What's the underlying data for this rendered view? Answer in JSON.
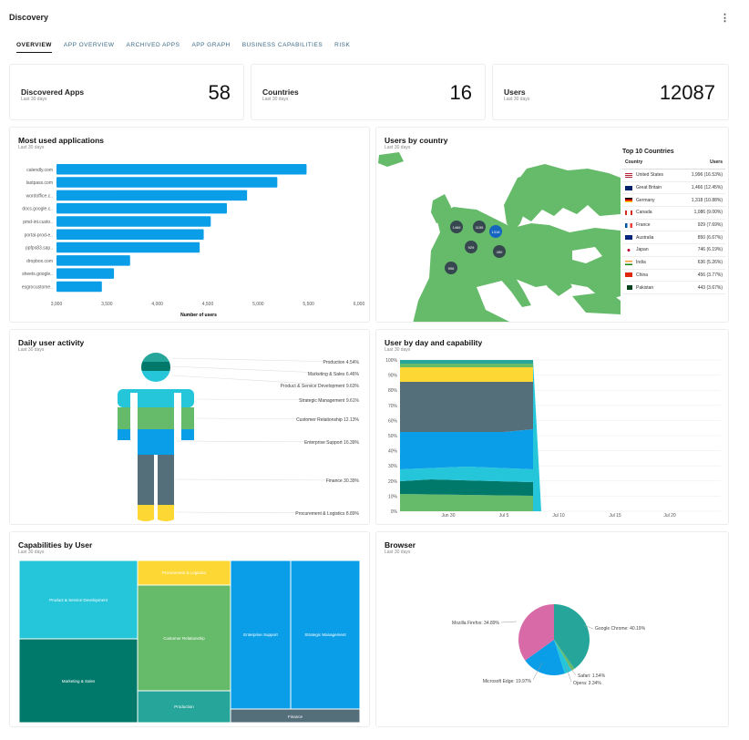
{
  "header": {
    "title": "Discovery",
    "menu_icon": "kebab-menu-icon"
  },
  "tabs": [
    "OVERVIEW",
    "APP OVERVIEW",
    "ARCHIVED APPS",
    "APP GRAPH",
    "BUSINESS CAPABILITIES",
    "RISK"
  ],
  "stats": [
    {
      "title": "Discovered Apps",
      "sub": "Last 30 days",
      "value": "58"
    },
    {
      "title": "Countries",
      "sub": "Last 30 days",
      "value": "16"
    },
    {
      "title": "Users",
      "sub": "Last 30 days",
      "value": "12087"
    }
  ],
  "most_used": {
    "title": "Most used applications",
    "sub": "Last 30 days",
    "chart_data": {
      "type": "bar",
      "orientation": "horizontal",
      "categories": [
        "calendly.com",
        "lastpass.com",
        "wordoffice.c..",
        "docs.google.c..",
        "pmd-int.custo..",
        "portal-prod-e..",
        "ppfps83.sap..",
        "dropbox.com",
        "sheets.google..",
        "esgrocustome.."
      ],
      "values": [
        5480,
        5190,
        4890,
        4690,
        4530,
        4460,
        4420,
        3730,
        3570,
        3450
      ],
      "xlabel": "Number of users",
      "xticks": [
        "3,000",
        "3,500",
        "4,000",
        "4,500",
        "5,000",
        "5,500",
        "6,000"
      ],
      "xlim": [
        3000,
        6000
      ],
      "color": "#0a9ee8"
    }
  },
  "users_by_country": {
    "title": "Users by country",
    "sub": "Last 30 days",
    "map_clusters": [
      "1466",
      "1155",
      "1318",
      "929",
      "450",
      "996"
    ],
    "top10": {
      "title": "Top 10 Countries",
      "col_country": "Country",
      "col_users": "Users",
      "rows": [
        {
          "country": "United States",
          "users": "1,996 (16.53%)"
        },
        {
          "country": "Great Britain",
          "users": "1,466 (12.45%)"
        },
        {
          "country": "Germany",
          "users": "1,318 (10.88%)"
        },
        {
          "country": "Canada",
          "users": "1,086 (9.00%)"
        },
        {
          "country": "France",
          "users": "929 (7.69%)"
        },
        {
          "country": "Australia",
          "users": "850 (6.67%)"
        },
        {
          "country": "Japan",
          "users": "746 (6.19%)"
        },
        {
          "country": "India",
          "users": "636 (5.26%)"
        },
        {
          "country": "China",
          "users": "456 (3.77%)"
        },
        {
          "country": "Pakistan",
          "users": "443 (3.67%)"
        }
      ]
    }
  },
  "daily_activity": {
    "title": "Daily user activity",
    "sub": "Last 30 days",
    "labels": [
      "Production 4.54%",
      "Marketing & Sales 6.46%",
      "Product & Service Development 9.63%",
      "Strategic Management 9.61%",
      "Customer Relationship 12.13%",
      "Enterprise Support 16.39%",
      "Finance 30.39%",
      "Procurement & Logistics 8.89%"
    ],
    "colors": {
      "teal": "#26a69a",
      "dark_teal": "#00796b",
      "light_blue": "#26c6da",
      "blue": "#1e88e5",
      "green": "#66bb6a",
      "slate": "#546e7a",
      "yellow": "#fdd835"
    }
  },
  "by_day_capability": {
    "title": "User by day and capability",
    "sub": "Last 30 days",
    "chart_data": {
      "type": "area",
      "stacked": "percent",
      "yticks": [
        "0%",
        "10%",
        "20%",
        "30%",
        "40%",
        "50%",
        "60%",
        "70%",
        "80%",
        "90%",
        "100%"
      ],
      "xticks": [
        "Jun 30",
        "Jul 5",
        "Jul 10",
        "Jul 15",
        "Jul 20"
      ]
    }
  },
  "capabilities_by_user": {
    "title": "Capabilities by User",
    "sub": "Last 30 days",
    "chart_data": {
      "type": "treemap",
      "cells": [
        "Product & Service Development",
        "Marketing & Sales",
        "Procurement & Logistics",
        "Customer Relationship",
        "Production",
        "Enterprise Support",
        "Strategic Management",
        "Finance"
      ]
    }
  },
  "browser": {
    "title": "Browser",
    "sub": "Last 30 days",
    "chart_data": {
      "type": "pie",
      "labels": [
        "Google Chrome",
        "Safari",
        "Opera",
        "Microsoft Edge",
        "Mozilla Firefox"
      ],
      "values": [
        40.19,
        1.54,
        3.34,
        19.97,
        34.89
      ],
      "label_texts": [
        "Google Chrome: 40.19%",
        "Safari: 1.54%",
        "Opera: 3.34%",
        "Microsoft Edge: 19.97%",
        "Mozilla Firefox: 34.89%"
      ],
      "colors": [
        "#26a69a",
        "#66bb6a",
        "#26c6da",
        "#0a9ee8",
        "#d96aa8"
      ]
    }
  }
}
